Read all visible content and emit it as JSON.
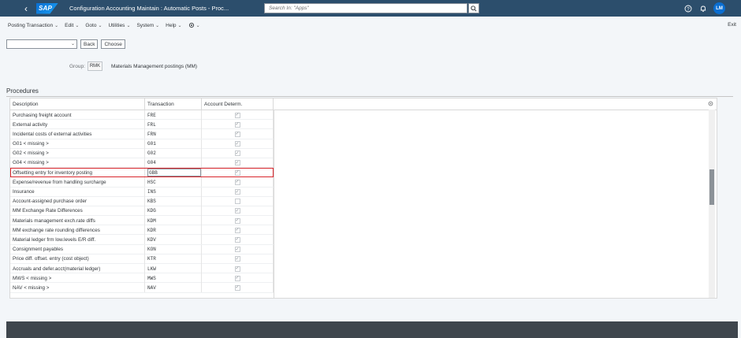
{
  "shell": {
    "logo": "SAP",
    "title": "Configuration Accounting Maintain : Automatic Posts - Proc...",
    "search_placeholder": "Search In: \"Apps\"",
    "avatar_initials": "LM"
  },
  "menu": {
    "items": [
      "Posting Transaction",
      "Edit",
      "Goto",
      "Utilities",
      "System",
      "Help"
    ],
    "exit": "Exit"
  },
  "toolbar": {
    "back": "Back",
    "choose": "Choose"
  },
  "group": {
    "label": "Group:",
    "value": "RMK",
    "description": "Materials Management postings (MM)"
  },
  "section": {
    "title": "Procedures"
  },
  "table": {
    "headers": {
      "description": "Description",
      "transaction": "Transaction",
      "account_determ": "Account Determ."
    },
    "rows": [
      {
        "description": "Purchasing freight account",
        "transaction": "FRE",
        "checked": true
      },
      {
        "description": "External activity",
        "transaction": "FRL",
        "checked": true
      },
      {
        "description": "Incidental costs of external activities",
        "transaction": "FRN",
        "checked": true
      },
      {
        "description": "G01 < missing >",
        "transaction": "G01",
        "checked": true
      },
      {
        "description": "G02 < missing >",
        "transaction": "G02",
        "checked": true
      },
      {
        "description": "G04 < missing >",
        "transaction": "G04",
        "checked": true
      },
      {
        "description": "Offsetting entry for inventory posting",
        "transaction": "GBB",
        "checked": true,
        "selected": true
      },
      {
        "description": "Expense/revenue from handling surcharge",
        "transaction": "HSC",
        "checked": true
      },
      {
        "description": "Insurance",
        "transaction": "INS",
        "checked": true
      },
      {
        "description": "Account-assigned purchase order",
        "transaction": "KBS",
        "checked": false
      },
      {
        "description": "MM Exchange Rate Differences",
        "transaction": "KDG",
        "checked": true
      },
      {
        "description": "Materials management exch.rate diffs",
        "transaction": "KDM",
        "checked": true
      },
      {
        "description": "MM exchange rate rounding differences",
        "transaction": "KDR",
        "checked": true
      },
      {
        "description": "Material ledger frm low.levels E/R diff.",
        "transaction": "KDV",
        "checked": true
      },
      {
        "description": "Consignment payables",
        "transaction": "KON",
        "checked": true
      },
      {
        "description": "Price diff. offset. entry (cost object)",
        "transaction": "KTR",
        "checked": true
      },
      {
        "description": "Accruals and defer.acct(material ledger)",
        "transaction": "LKW",
        "checked": true
      },
      {
        "description": "MWS < missing >",
        "transaction": "MWS",
        "checked": true
      },
      {
        "description": "NAV < missing >",
        "transaction": "NAV",
        "checked": true
      }
    ]
  },
  "icons": {
    "back": "chevron-left-icon",
    "search": "search-icon",
    "help": "help-icon",
    "notifications": "bell-icon",
    "settings": "settings-icon"
  },
  "colors": {
    "shell_bg": "#2c4e6c",
    "selected_outline": "#d9262c",
    "footer_bg": "#3f464d"
  }
}
